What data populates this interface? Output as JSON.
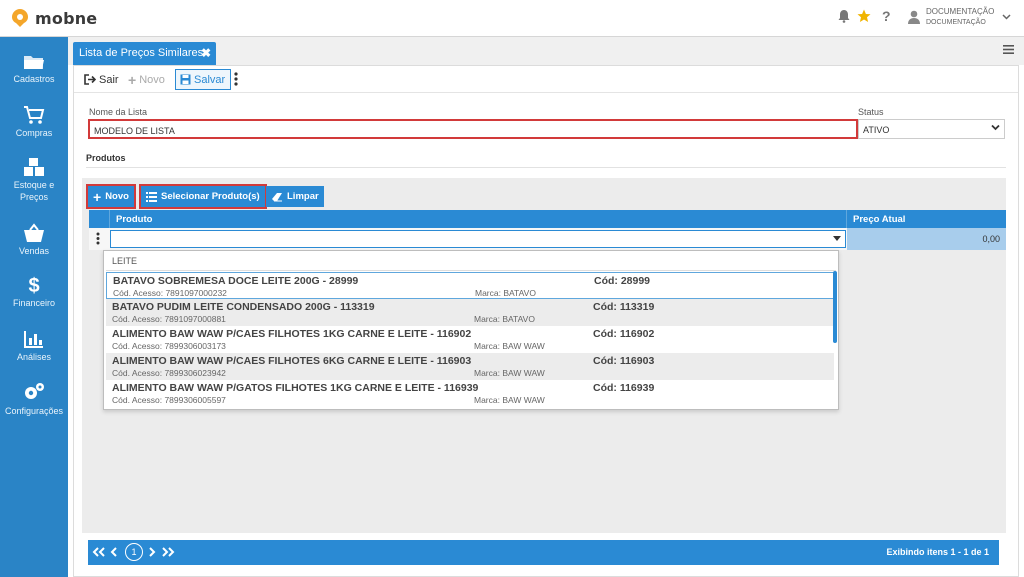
{
  "app": {
    "brand": "mobne"
  },
  "user": {
    "name": "DOCUMENTAÇÃO",
    "company": "DOCUMENTAÇÃO"
  },
  "sidebar": {
    "items": [
      {
        "label": "Cadastros",
        "icon": "folder-icon"
      },
      {
        "label": "Compras",
        "icon": "cart-icon"
      },
      {
        "label": "Estoque e",
        "label2": "Preços",
        "icon": "boxes-icon"
      },
      {
        "label": "Vendas",
        "icon": "basket-icon"
      },
      {
        "label": "Financeiro",
        "icon": "dollar-icon"
      },
      {
        "label": "Análises",
        "icon": "bar-chart-icon"
      },
      {
        "label": "Configurações",
        "icon": "gears-icon"
      }
    ]
  },
  "tab": {
    "title": "Lista de Preços Similares"
  },
  "toolbar": {
    "exit_label": "Sair",
    "new_label": "Novo",
    "save_label": "Salvar"
  },
  "form": {
    "name_label": "Nome da Lista",
    "name_value": "MODELO DE LISTA",
    "status_label": "Status",
    "status_value": "ATIVO"
  },
  "products": {
    "section_title": "Produtos",
    "buttons": {
      "new": "Novo",
      "select": "Selecionar Produto(s)",
      "clear": "Limpar"
    },
    "columns": [
      "Produto",
      "Preço Atual"
    ],
    "row_price": "0,00",
    "search_text": "LEITE",
    "options": [
      {
        "name": "BATAVO SOBREMESA DOCE LEITE 200G - 28999",
        "code": "Cód: 28999",
        "access": "Cód. Acesso: 7891097000232",
        "brand": "Marca: BATAVO"
      },
      {
        "name": "BATAVO PUDIM LEITE CONDENSADO 200G - 113319",
        "code": "Cód: 113319",
        "access": "Cód. Acesso: 7891097000881",
        "brand": "Marca: BATAVO"
      },
      {
        "name": "ALIMENTO BAW WAW P/CAES FILHOTES 1KG CARNE E LEITE - 116902",
        "code": "Cód: 116902",
        "access": "Cód. Acesso: 7899306003173",
        "brand": "Marca: BAW WAW"
      },
      {
        "name": "ALIMENTO BAW WAW P/CAES FILHOTES 6KG CARNE E LEITE - 116903",
        "code": "Cód: 116903",
        "access": "Cód. Acesso: 7899306023942",
        "brand": "Marca: BAW WAW"
      },
      {
        "name": "ALIMENTO BAW WAW P/GATOS FILHOTES 1KG CARNE E LEITE - 116939",
        "code": "Cód: 116939",
        "access": "Cód. Acesso: 7899306005597",
        "brand": "Marca: BAW WAW"
      }
    ]
  },
  "pager": {
    "current_page": "1",
    "info": "Exibindo itens 1 - 1 de 1"
  },
  "colors": {
    "primary": "#2a8ad4",
    "sidebar": "#2a84c6",
    "highlight": "#d23a3a",
    "logo": "#f4a62a"
  }
}
